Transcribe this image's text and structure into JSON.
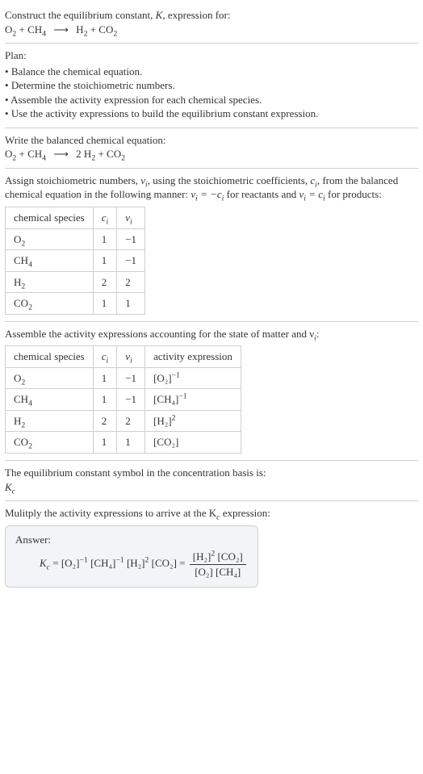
{
  "prompt": {
    "line1": "Construct the equilibrium constant, K, expression for:",
    "eq_lhs1": "O",
    "eq_rhs1": " + CH",
    "eq_arrow": "⟶",
    "eq_prod1": "H",
    "eq_prod2": " + CO"
  },
  "plan": {
    "heading": "Plan:",
    "items": [
      "Balance the chemical equation.",
      "Determine the stoichiometric numbers.",
      "Assemble the activity expression for each chemical species.",
      "Use the activity expressions to build the equilibrium constant expression."
    ]
  },
  "balanced": {
    "heading": "Write the balanced chemical equation:",
    "coef_h2": "2"
  },
  "assign": {
    "text_a": "Assign stoichiometric numbers, ",
    "text_b": ", using the stoichiometric coefficients, ",
    "text_c": ", from the balanced chemical equation in the following manner: ",
    "text_d": " for reactants and ",
    "text_e": " for products:",
    "nu_i": "ν",
    "c_i": "c",
    "rel1a": "ν",
    "rel1b": " = −c",
    "rel2a": "ν",
    "rel2b": " = c",
    "headers": {
      "species": "chemical species",
      "ci": "c",
      "nui": "ν"
    },
    "rows": [
      {
        "species": "O₂",
        "ci": "1",
        "nui": "−1"
      },
      {
        "species": "CH₄",
        "ci": "1",
        "nui": "−1"
      },
      {
        "species": "H₂",
        "ci": "2",
        "nui": "2"
      },
      {
        "species": "CO₂",
        "ci": "1",
        "nui": "1"
      }
    ]
  },
  "activity": {
    "heading": "Assemble the activity expressions accounting for the state of matter and ν",
    "heading_tail": ":",
    "headers": {
      "species": "chemical species",
      "ci": "c",
      "nui": "ν",
      "act": "activity expression"
    },
    "rows": [
      {
        "species": "O₂",
        "ci": "1",
        "nui": "−1",
        "act_base": "[O₂]",
        "act_exp": "−1"
      },
      {
        "species": "CH₄",
        "ci": "1",
        "nui": "−1",
        "act_base": "[CH₄]",
        "act_exp": "−1"
      },
      {
        "species": "H₂",
        "ci": "2",
        "nui": "2",
        "act_base": "[H₂]",
        "act_exp": "2"
      },
      {
        "species": "CO₂",
        "ci": "1",
        "nui": "1",
        "act_base": "[CO₂]",
        "act_exp": ""
      }
    ]
  },
  "ksymbol": {
    "line": "The equilibrium constant symbol in the concentration basis is:",
    "sym": "K",
    "sub": "c"
  },
  "final": {
    "line": "Mulitply the activity expressions to arrive at the K",
    "line_tail": " expression:",
    "answer_label": "Answer:",
    "kc": "K",
    "kc_sub": "c",
    "terms": {
      "o2": "[O₂]",
      "o2_exp": "−1",
      "ch4": "[CH₄]",
      "ch4_exp": "−1",
      "h2": "[H₂]",
      "h2_exp": "2",
      "co2": "[CO₂]"
    },
    "frac_num_a": "[H₂]",
    "frac_num_a_exp": "2",
    "frac_num_b": " [CO₂]",
    "frac_den": "[O₂] [CH₄]"
  }
}
